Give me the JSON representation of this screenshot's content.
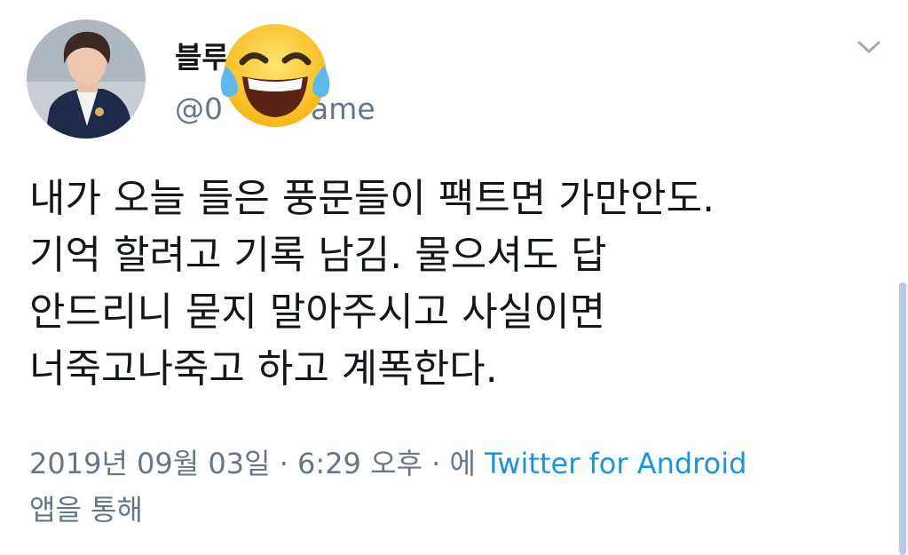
{
  "user": {
    "display_name": "블루",
    "handle": "@0　　　ame",
    "avatar_icon": "profile-photo"
  },
  "header": {
    "menu_icon": "chevron-down-icon",
    "sticker_icon": "tears-of-joy-emoji-icon"
  },
  "tweet": {
    "lines": [
      "내가 오늘 들은 풍문들이 팩트면 가만안도.",
      "기억 할려고 기록 남김. 물으셔도 답",
      "안드리니 묻지 말아주시고 사실이면",
      "너죽고나죽고 하고 계폭한다."
    ]
  },
  "meta": {
    "timestamp": "2019년 09월 03일 · 6:29 오후 · 에",
    "client": "Twitter for Android",
    "suffix": "앱을 통해"
  },
  "colors": {
    "text": "#14171a",
    "secondary": "#657786",
    "link": "#1b95e0"
  }
}
